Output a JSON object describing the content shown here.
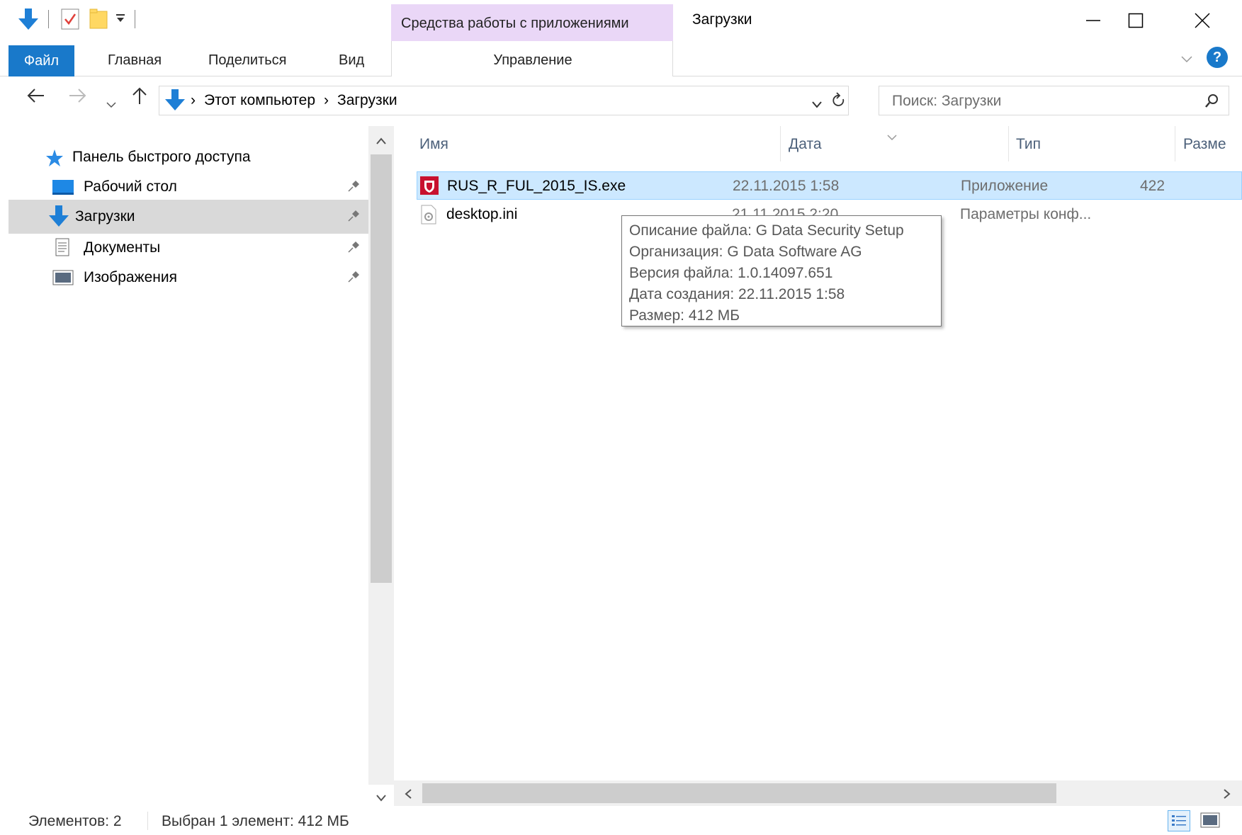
{
  "titlebar": {
    "context_tab_title": "Средства работы с приложениями",
    "window_title": "Загрузки",
    "min_label": "—",
    "max_label": "☐",
    "close_label": "✕"
  },
  "ribbon": {
    "tab_file": "Файл",
    "tab_home": "Главная",
    "tab_share": "Поделиться",
    "tab_view": "Вид",
    "tab_manage": "Управление",
    "help_label": "?"
  },
  "address": {
    "crumb_1": "Этот компьютер",
    "crumb_2": "Загрузки",
    "sep": "›"
  },
  "search": {
    "placeholder": "Поиск: Загрузки"
  },
  "nav": {
    "quick_access": "Панель быстрого доступа",
    "items": [
      {
        "label": "Рабочий стол"
      },
      {
        "label": "Загрузки"
      },
      {
        "label": "Документы"
      },
      {
        "label": "Изображения"
      }
    ]
  },
  "columns": {
    "name": "Имя",
    "date": "Дата",
    "type": "Тип",
    "size": "Разме"
  },
  "files": [
    {
      "name": "RUS_R_FUL_2015_IS.exe",
      "date": "22.11.2015 1:58",
      "type": "Приложение",
      "size": "422"
    },
    {
      "name": "desktop.ini",
      "date": "21.11.2015 2:20",
      "type": "Параметры конф...",
      "size": ""
    }
  ],
  "tooltip": {
    "line1": "Описание файла: G Data Security Setup",
    "line2": "Организация: G Data Software AG",
    "line3": "Версия файла: 1.0.14097.651",
    "line4": "Дата создания: 22.11.2015 1:58",
    "line5": "Размер: 412 МБ"
  },
  "status": {
    "count": "Элементов: 2",
    "selection": "Выбран 1 элемент: 412 МБ"
  },
  "colors": {
    "accent": "#1979ca",
    "selection": "#cce8ff",
    "context_tab": "#ead7f7",
    "gdata_red": "#c8102e"
  }
}
